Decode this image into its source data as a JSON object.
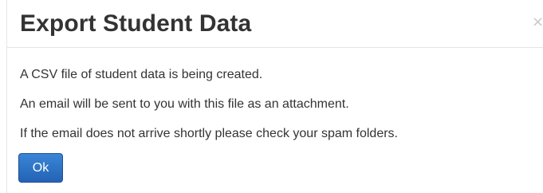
{
  "dialog": {
    "title": "Export Student Data",
    "close_glyph": "×",
    "close_icon": "close-icon",
    "messages": [
      "A CSV file of student data is being created.",
      "An email will be sent to you with this file as an attachment.",
      "If the email does not arrive shortly please check your spam folders."
    ],
    "ok_label": "Ok"
  },
  "colors": {
    "title_text": "#333333",
    "body_text": "#333333",
    "ok_button_bg": "#2d6fc4",
    "ok_button_text": "#ffffff",
    "close_icon": "#c8c8c8"
  }
}
